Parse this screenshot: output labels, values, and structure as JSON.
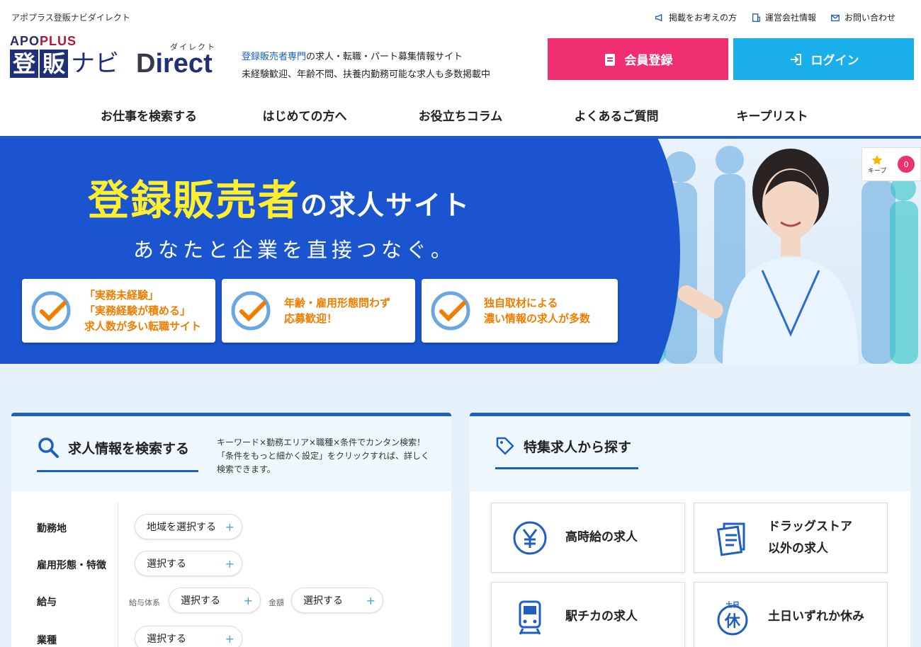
{
  "header": {
    "tagline_top": "アポプラス登販ナビダイレクト",
    "top_links": [
      {
        "label": "掲載をお考えの方",
        "icon": "megaphone-icon"
      },
      {
        "label": "運営会社情報",
        "icon": "building-icon"
      },
      {
        "label": "お問い合わせ",
        "icon": "mail-icon"
      }
    ],
    "logo": {
      "apo": "APO",
      "plus": "PLUS",
      "kanji1": "登",
      "kanji2": "販",
      "navi": "ナビ",
      "direct_d": "D",
      "direct_rest": "irect",
      "ruby": "ダイレクト"
    },
    "desc_accent": "登録販売者専門",
    "desc_line1_rest": "の求人・転職・パート募集情報サイト",
    "desc_line2": "未経験歓迎、年齢不問、扶養内勤務可能な求人も多数掲載中",
    "register_label": "会員登録",
    "login_label": "ログイン"
  },
  "nav": {
    "items": [
      "お仕事を検索する",
      "はじめての方へ",
      "お役立ちコラム",
      "よくあるご質問",
      "キープリスト"
    ]
  },
  "hero": {
    "title_big": "登録販売者",
    "title_rest": "の求人サイト",
    "subtitle": "あなたと企業を直接つなぐ。",
    "features": [
      [
        "「実務未経験」",
        "「実務経験が積める」",
        "求人数が多い転職サイト"
      ],
      [
        "年齢・雇用形態問わず",
        "応募歓迎！"
      ],
      [
        "独自取材による",
        "濃い情報の求人が多数"
      ]
    ],
    "keep_label": "キープ",
    "keep_count": "0"
  },
  "search": {
    "title": "求人情報を検索する",
    "description": "キーワード×勤務エリア×職種×条件でカンタン検索！「条件をもっと細かく設定」をクリックすれば、詳しく検索できます。",
    "rows": {
      "area_label": "勤務地",
      "area_value": "地域を選択する",
      "employment_label": "雇用形態・特徴",
      "employment_value": "選択する",
      "salary_label": "給与",
      "salary_type_label": "給与体系",
      "salary_type_value": "選択する",
      "salary_amount_label": "金額",
      "salary_amount_value": "選択する",
      "industry_label": "業種",
      "industry_value": "選択する"
    }
  },
  "featured": {
    "title": "特集求人から探す",
    "cards": [
      {
        "lines": [
          "高時給の求人"
        ],
        "icon": "yen-icon"
      },
      {
        "lines": [
          "ドラッグストア",
          "以外の求人"
        ],
        "icon": "document-icon"
      },
      {
        "lines": [
          "駅チカの求人"
        ],
        "icon": "train-icon"
      },
      {
        "lines": [
          "土日いずれか休み"
        ],
        "icon": "weekend-holiday-icon",
        "icon_text_top": "土日",
        "icon_text_main": "休"
      }
    ]
  },
  "colors": {
    "brand_blue": "#1f5fc2",
    "register_pink": "#ef2f72",
    "login_cyan": "#1aaeea",
    "hero_blue": "#1a55cf",
    "hero_yellow": "#ffee2e",
    "feature_orange": "#f07d00"
  }
}
